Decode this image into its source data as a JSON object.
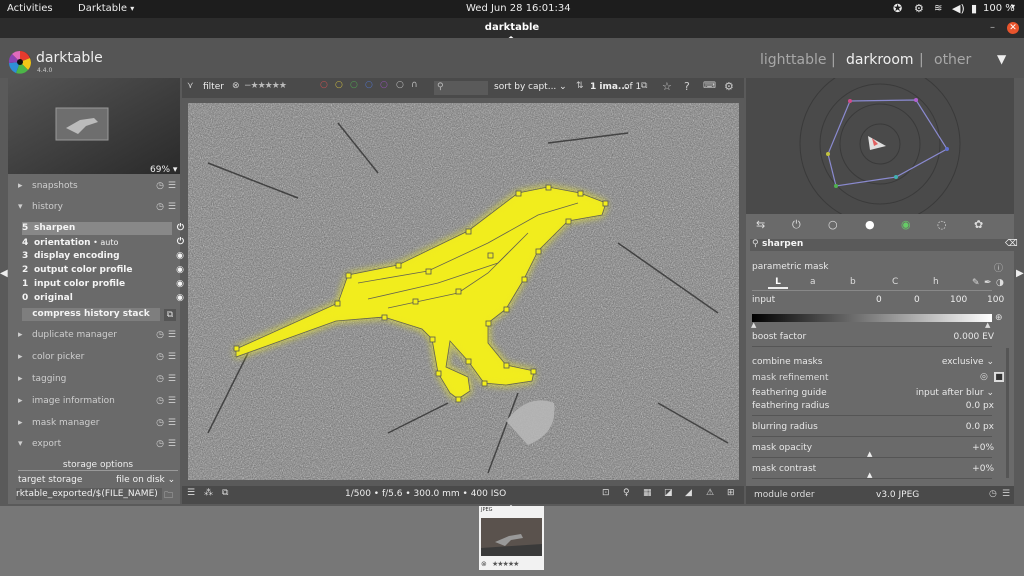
{
  "system_bar": {
    "activities": "Activities",
    "app_menu": "Darktable",
    "clock": "Wed Jun 28  16:01:34",
    "battery": "100 %"
  },
  "window": {
    "title": "darktable"
  },
  "app_header": {
    "logo_text": "darktable",
    "version": "4.4.0",
    "views": [
      {
        "label": "lighttable",
        "active": false
      },
      {
        "label": "darkroom",
        "active": true
      },
      {
        "label": "other",
        "active": false
      }
    ],
    "separator": "|"
  },
  "left_panel": {
    "zoom": "69%",
    "modules_top": [
      {
        "label": "snapshots",
        "expanded": false
      },
      {
        "label": "history",
        "expanded": true
      }
    ],
    "history_items": [
      {
        "index": "5",
        "label": "sharpen",
        "suffix": "",
        "selected": true
      },
      {
        "index": "4",
        "label": "orientation",
        "suffix": " • auto",
        "selected": false
      },
      {
        "index": "3",
        "label": "display encoding",
        "suffix": "",
        "selected": false
      },
      {
        "index": "2",
        "label": "output color profile",
        "suffix": "",
        "selected": false
      },
      {
        "index": "1",
        "label": "input color profile",
        "suffix": "",
        "selected": false
      },
      {
        "index": "0",
        "label": "original",
        "suffix": "",
        "selected": false
      }
    ],
    "compress_button": "compress history stack",
    "modules_bottom": [
      {
        "label": "duplicate manager"
      },
      {
        "label": "color picker"
      },
      {
        "label": "tagging"
      },
      {
        "label": "image information"
      },
      {
        "label": "mask manager"
      }
    ],
    "export_label": "export",
    "storage_options": "storage options",
    "target_storage_label": "target storage",
    "target_storage_value": "file on disk",
    "export_path": "rktable_exported/$(FILE_NAME)"
  },
  "center_toolbar": {
    "filter_label": "filter",
    "sort_label": "sort by",
    "sort_value": "capt...",
    "count": "1 ima...",
    "of_label": "of 1"
  },
  "bottom_bar": {
    "exif": "1/500 • f/5.6 • 300.0 mm • 400 ISO"
  },
  "right_panel": {
    "search_value": "sharpen",
    "parametric_mask": "parametric mask",
    "channel_tabs": [
      "L",
      "a",
      "b",
      "C",
      "h"
    ],
    "input_label": "input",
    "input_values": [
      "0",
      "0",
      "100",
      "100"
    ],
    "boost_factor_label": "boost factor",
    "boost_factor_value": "0.000 EV",
    "combine_masks_label": "combine masks",
    "combine_masks_value": "exclusive",
    "mask_refinement_label": "mask refinement",
    "feathering_guide_label": "feathering guide",
    "feathering_guide_value": "input after blur",
    "feathering_radius_label": "feathering radius",
    "feathering_radius_value": "0.0 px",
    "blurring_radius_label": "blurring radius",
    "blurring_radius_value": "0.0 px",
    "mask_opacity_label": "mask opacity",
    "mask_opacity_value": "+0%",
    "mask_contrast_label": "mask contrast",
    "mask_contrast_value": "+0%",
    "module_order_label": "module order",
    "module_order_value": "v3.0 JPEG"
  },
  "filmstrip": {
    "thumb_label": "JPEG"
  },
  "colors": {
    "mask_yellow": "#f2ee1c",
    "accent_active": "#f0f0f0",
    "panel_bg": "#6a6a6a"
  }
}
